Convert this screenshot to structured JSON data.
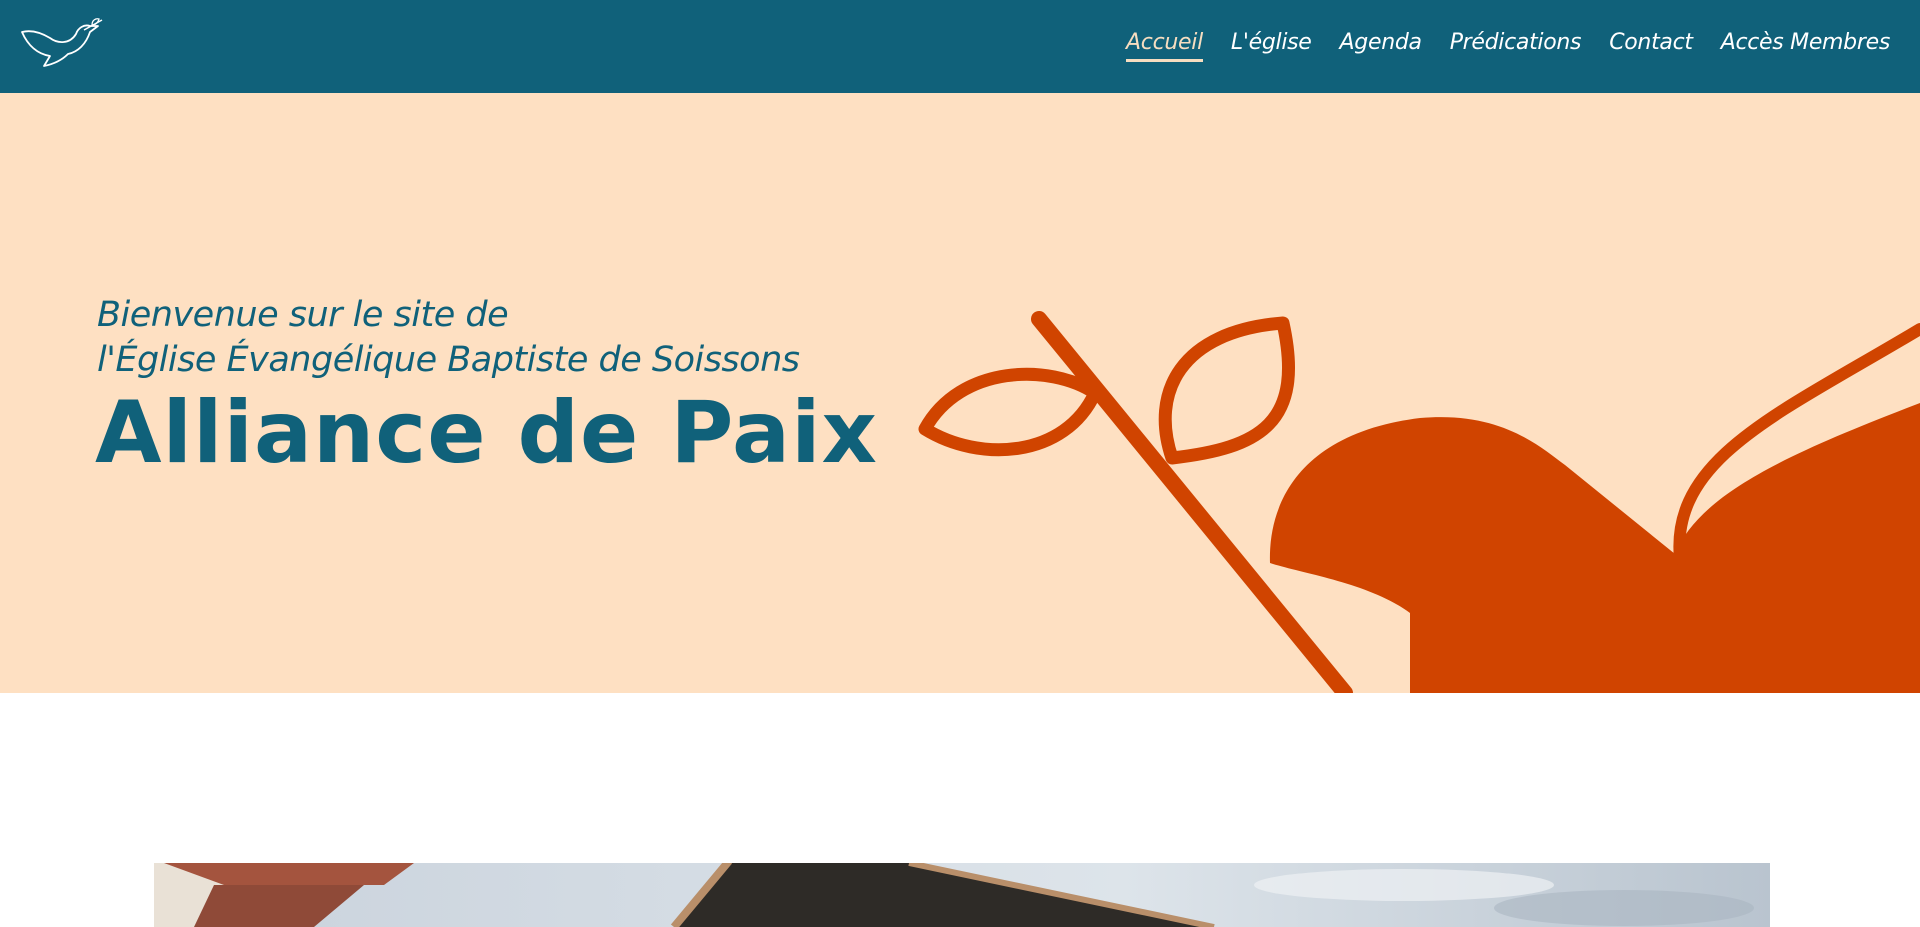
{
  "nav": {
    "items": [
      {
        "label": "Accueil",
        "active": true
      },
      {
        "label": "L'église",
        "active": false
      },
      {
        "label": "Agenda",
        "active": false
      },
      {
        "label": "Prédications",
        "active": false
      },
      {
        "label": "Contact",
        "active": false
      },
      {
        "label": "Accès Membres",
        "active": false
      }
    ]
  },
  "hero": {
    "welcome_line1": "Bienvenue sur le site de",
    "welcome_line2": "l'Église Évangélique Baptiste de Soissons",
    "title": "Alliance de Paix"
  },
  "icons": {
    "logo": "dove-logo-icon",
    "hero_art": "dove-illustration"
  },
  "colors": {
    "nav_bg": "#10617a",
    "hero_bg": "#fee0c2",
    "accent": "#d04400",
    "title": "#10617a",
    "active_link": "#f6ddc0"
  }
}
